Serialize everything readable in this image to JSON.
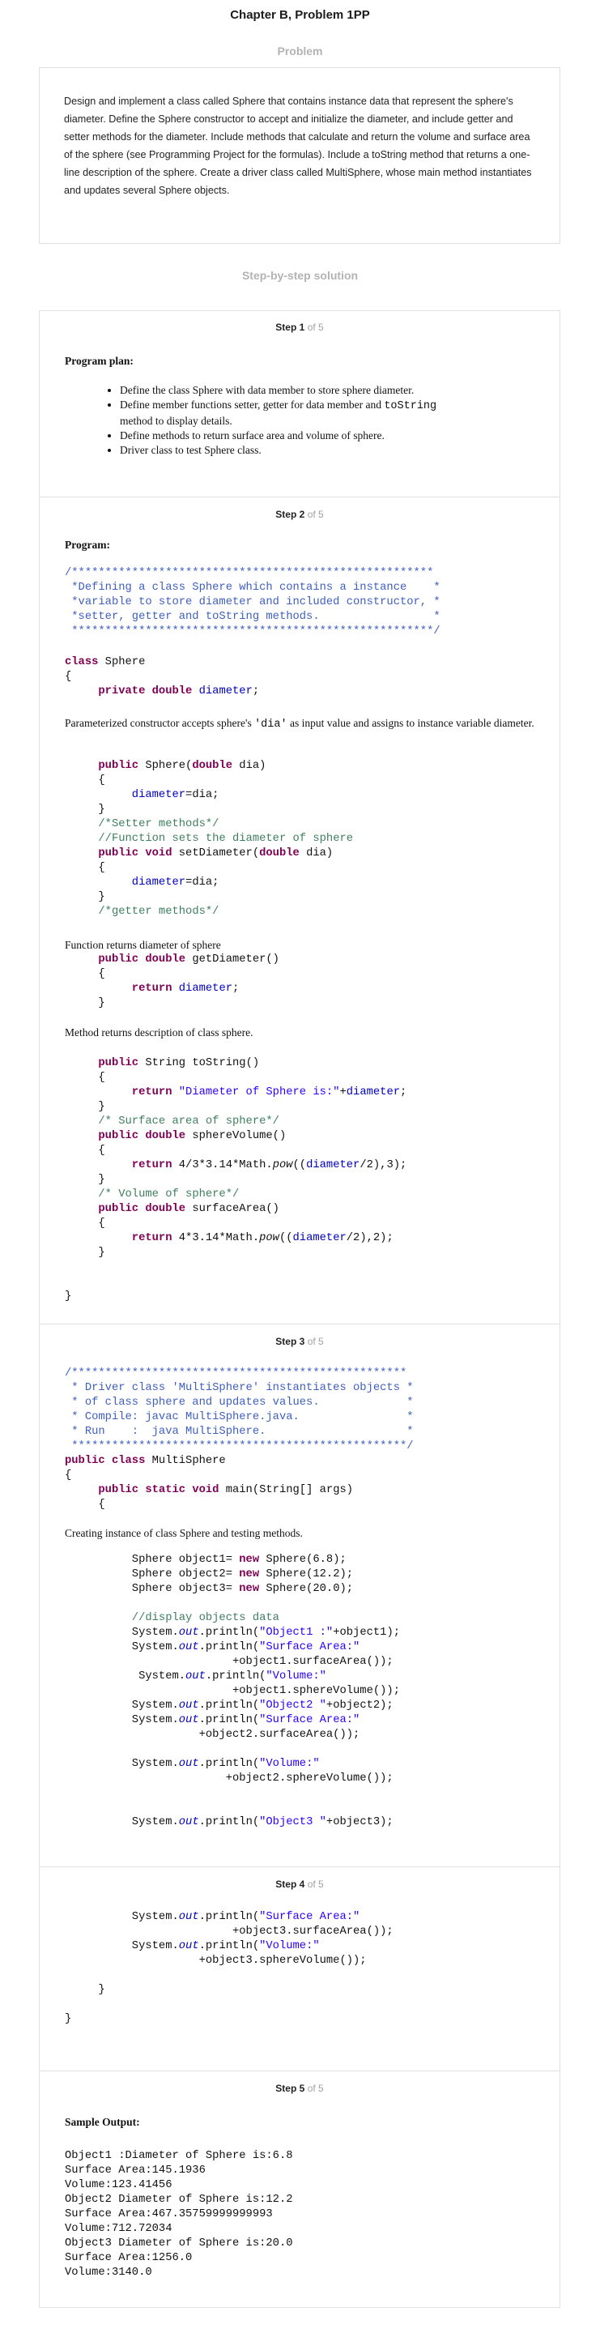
{
  "header": {
    "title": "Chapter B, Problem 1PP",
    "problem_label": "Problem",
    "solution_label": "Step-by-step solution"
  },
  "problem": {
    "text": "Design and implement a class called Sphere that contains instance data that represent the sphere's diameter. Define the Sphere constructor to accept and initialize the diameter, and include getter and setter methods for the diameter. Include methods that calculate and return the volume and surface area of the sphere (see Programming Project for the formulas). Include a toString method that returns a one-line description of the sphere. Create a driver class called MultiSphere, whose main method instantiates and updates several Sphere objects."
  },
  "steps": [
    {
      "word": "Step",
      "num": "1",
      "of": "of 5"
    },
    {
      "word": "Step",
      "num": "2",
      "of": "of 5"
    },
    {
      "word": "Step",
      "num": "3",
      "of": "of 5"
    },
    {
      "word": "Step",
      "num": "4",
      "of": "of 5"
    },
    {
      "word": "Step",
      "num": "5",
      "of": "of 5"
    }
  ],
  "step1": {
    "heading": "Program plan:",
    "bullets": [
      "Define the class Sphere with data member to store sphere diameter.",
      "Define member functions setter, getter for data member and ",
      "method to display details.",
      "Define methods to return surface area and volume of sphere.",
      "Driver class to test Sphere class."
    ],
    "tostring_code": "toString"
  },
  "step2": {
    "heading": "Program:",
    "comment_lines": [
      "/******************************************************",
      " *Defining a class Sphere which contains a instance    *",
      " *variable to store diameter and included constructor, *",
      " *setter, getter and toString methods.                 *",
      " ******************************************************/"
    ],
    "ctor_desc_a": " Parameterized constructor accepts sphere's ",
    "ctor_desc_code": "'dia'",
    "ctor_desc_b": " as input value and assigns to instance variable diameter.",
    "getter_desc": "Function returns diameter of sphere",
    "tostring_desc": "Method returns description of class sphere.",
    "setter_comment": "/*Setter methods*/",
    "setter_comment2": "//Function sets the diameter of sphere",
    "getter_comment": "/*getter methods*/",
    "tostring_str": "\"Diameter of Sphere is:\"",
    "surface_comment": "/* Surface area of sphere*/",
    "volume_comment": "/* Volume of sphere*/"
  },
  "step3": {
    "comment_lines": [
      "/**************************************************",
      " * Driver class 'MultiSphere' instantiates objects *",
      " * of class sphere and updates values.             *",
      " * Compile: javac MultiSphere.java.                *",
      " * Run    :  java MultiSphere.                     *",
      " **************************************************/"
    ],
    "desc": "Creating instance of class Sphere and testing methods.",
    "display_comment": "//display objects data",
    "s_obj1": "\"Object1 :\"",
    "s_surf": "\"Surface Area:\"",
    "s_vol": "\"Volume:\"",
    "s_obj2": "\"Object2 \"",
    "s_obj3": "\"Object3 \""
  },
  "step5": {
    "heading": "Sample Output:",
    "output": [
      "Object1 :Diameter of Sphere is:6.8",
      "Surface Area:145.1936",
      "Volume:123.41456",
      "Object2 Diameter of Sphere is:12.2",
      "Surface Area:467.35759999999993",
      "Volume:712.72034",
      "Object3 Diameter of Sphere is:20.0",
      "Surface Area:1256.0",
      "Volume:3140.0"
    ]
  }
}
